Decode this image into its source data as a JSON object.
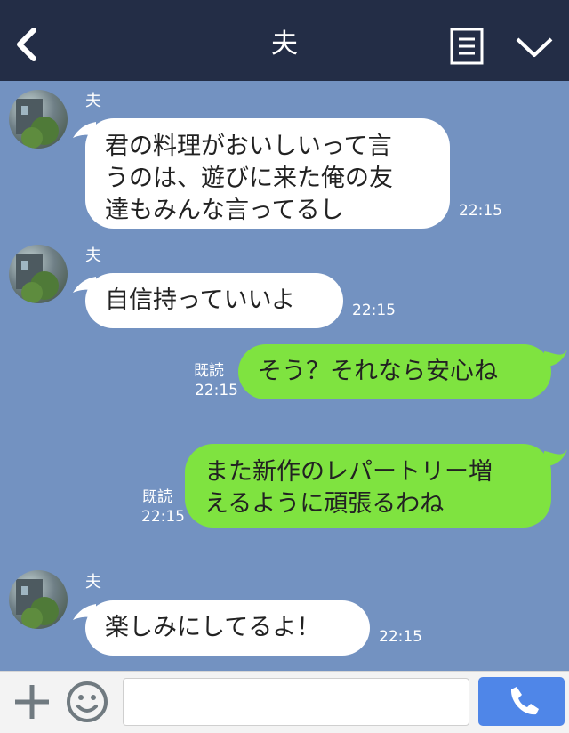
{
  "colors": {
    "header_bg": "#232d46",
    "chat_bg": "#7392c1",
    "incoming_bubble": "#ffffff",
    "outgoing_bubble": "#7fe340",
    "accent": "#4f86e8"
  },
  "header": {
    "title": "夫",
    "back_icon": "chevron-left-icon",
    "menu_icon": "list-icon",
    "collapse_icon": "chevron-down-icon"
  },
  "messages": [
    {
      "direction": "in",
      "sender": "夫",
      "text": "君の料理がおいしいって言\nうのは、遊びに来た俺の友\n達もみんな言ってるし",
      "time": "22:15"
    },
    {
      "direction": "in",
      "sender": "夫",
      "text": "自信持っていいよ",
      "time": "22:15"
    },
    {
      "direction": "out",
      "read": "既読",
      "text": "そう？それなら安心ね",
      "time": "22:15"
    },
    {
      "direction": "out",
      "read": "既読",
      "text": "また新作のレパートリー増\nえるように頑張るわね",
      "time": "22:15"
    },
    {
      "direction": "in",
      "sender": "夫",
      "text": "楽しみにしてるよ！",
      "time": "22:15"
    }
  ],
  "footer": {
    "plus_icon": "plus-icon",
    "emoji_icon": "smiley-icon",
    "input_value": "",
    "input_placeholder": "",
    "call_icon": "phone-icon"
  }
}
